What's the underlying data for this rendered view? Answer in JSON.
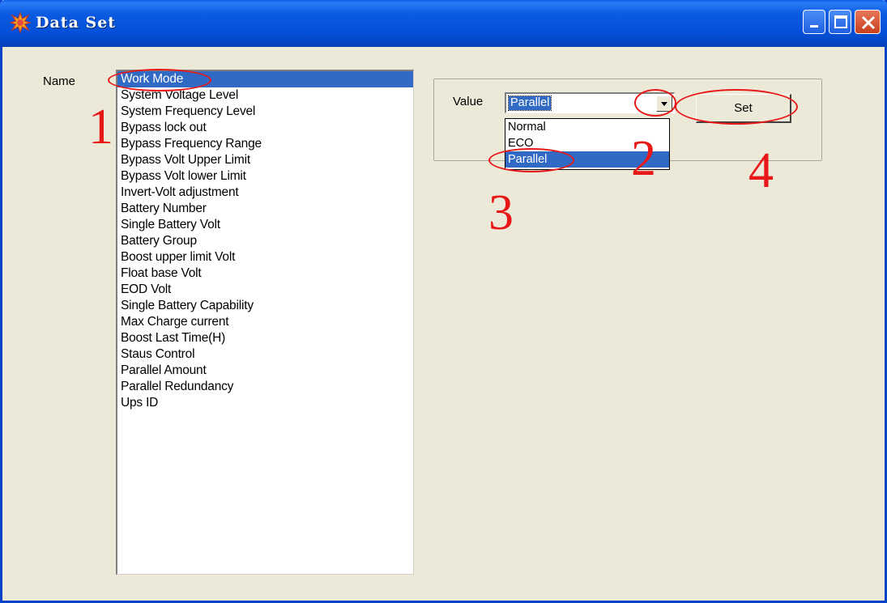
{
  "window": {
    "title": "Data Set"
  },
  "form": {
    "name_label": "Name",
    "value_label": "Value",
    "set_label": "Set"
  },
  "list": {
    "items": [
      "Work Mode",
      "System Voltage Level",
      "System Frequency Level",
      "Bypass lock out",
      "Bypass Frequency Range",
      "Bypass Volt Upper Limit",
      "Bypass Volt lower Limit",
      "Invert-Volt adjustment",
      "Battery Number",
      "Single Battery Volt",
      "Battery Group",
      "Boost upper limit Volt",
      "Float base Volt",
      "EOD Volt",
      "Single Battery Capability",
      "Max Charge current",
      "Boost Last Time(H)",
      "Staus Control",
      "Parallel Amount",
      "Parallel Redundancy",
      "Ups ID"
    ],
    "selected_index": 0
  },
  "combo": {
    "value": "Parallel",
    "options": [
      "Normal",
      "ECO",
      "Parallel"
    ],
    "selected_index": 2
  },
  "annotations": {
    "n1": "1",
    "n2": "2",
    "n3": "3",
    "n4": "4"
  },
  "colors": {
    "annotation": "#e81818",
    "selection": "#316ac5",
    "titlebar": "#0450d8"
  }
}
